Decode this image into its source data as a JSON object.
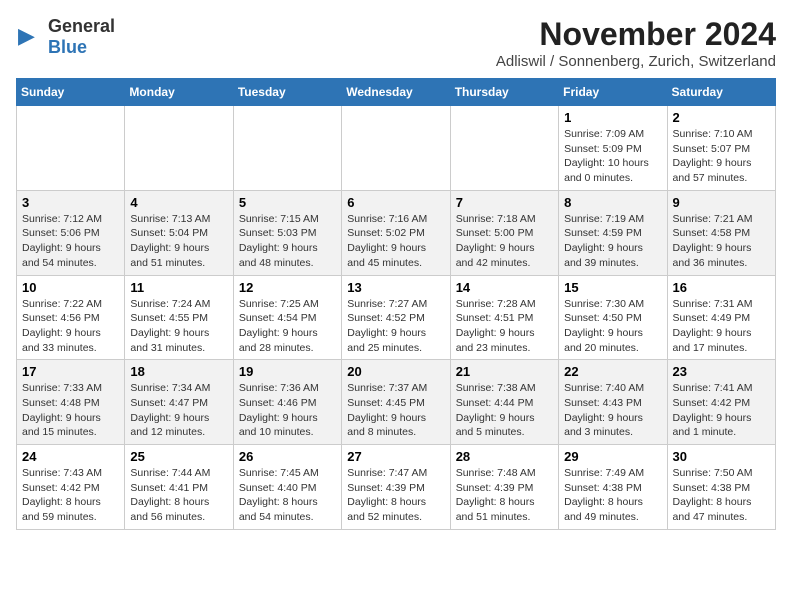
{
  "logo": {
    "text_general": "General",
    "text_blue": "Blue"
  },
  "title": "November 2024",
  "subtitle": "Adliswil / Sonnenberg, Zurich, Switzerland",
  "weekdays": [
    "Sunday",
    "Monday",
    "Tuesday",
    "Wednesday",
    "Thursday",
    "Friday",
    "Saturday"
  ],
  "weeks": [
    [
      {
        "day": "",
        "info": ""
      },
      {
        "day": "",
        "info": ""
      },
      {
        "day": "",
        "info": ""
      },
      {
        "day": "",
        "info": ""
      },
      {
        "day": "",
        "info": ""
      },
      {
        "day": "1",
        "info": "Sunrise: 7:09 AM\nSunset: 5:09 PM\nDaylight: 10 hours and 0 minutes."
      },
      {
        "day": "2",
        "info": "Sunrise: 7:10 AM\nSunset: 5:07 PM\nDaylight: 9 hours and 57 minutes."
      }
    ],
    [
      {
        "day": "3",
        "info": "Sunrise: 7:12 AM\nSunset: 5:06 PM\nDaylight: 9 hours and 54 minutes."
      },
      {
        "day": "4",
        "info": "Sunrise: 7:13 AM\nSunset: 5:04 PM\nDaylight: 9 hours and 51 minutes."
      },
      {
        "day": "5",
        "info": "Sunrise: 7:15 AM\nSunset: 5:03 PM\nDaylight: 9 hours and 48 minutes."
      },
      {
        "day": "6",
        "info": "Sunrise: 7:16 AM\nSunset: 5:02 PM\nDaylight: 9 hours and 45 minutes."
      },
      {
        "day": "7",
        "info": "Sunrise: 7:18 AM\nSunset: 5:00 PM\nDaylight: 9 hours and 42 minutes."
      },
      {
        "day": "8",
        "info": "Sunrise: 7:19 AM\nSunset: 4:59 PM\nDaylight: 9 hours and 39 minutes."
      },
      {
        "day": "9",
        "info": "Sunrise: 7:21 AM\nSunset: 4:58 PM\nDaylight: 9 hours and 36 minutes."
      }
    ],
    [
      {
        "day": "10",
        "info": "Sunrise: 7:22 AM\nSunset: 4:56 PM\nDaylight: 9 hours and 33 minutes."
      },
      {
        "day": "11",
        "info": "Sunrise: 7:24 AM\nSunset: 4:55 PM\nDaylight: 9 hours and 31 minutes."
      },
      {
        "day": "12",
        "info": "Sunrise: 7:25 AM\nSunset: 4:54 PM\nDaylight: 9 hours and 28 minutes."
      },
      {
        "day": "13",
        "info": "Sunrise: 7:27 AM\nSunset: 4:52 PM\nDaylight: 9 hours and 25 minutes."
      },
      {
        "day": "14",
        "info": "Sunrise: 7:28 AM\nSunset: 4:51 PM\nDaylight: 9 hours and 23 minutes."
      },
      {
        "day": "15",
        "info": "Sunrise: 7:30 AM\nSunset: 4:50 PM\nDaylight: 9 hours and 20 minutes."
      },
      {
        "day": "16",
        "info": "Sunrise: 7:31 AM\nSunset: 4:49 PM\nDaylight: 9 hours and 17 minutes."
      }
    ],
    [
      {
        "day": "17",
        "info": "Sunrise: 7:33 AM\nSunset: 4:48 PM\nDaylight: 9 hours and 15 minutes."
      },
      {
        "day": "18",
        "info": "Sunrise: 7:34 AM\nSunset: 4:47 PM\nDaylight: 9 hours and 12 minutes."
      },
      {
        "day": "19",
        "info": "Sunrise: 7:36 AM\nSunset: 4:46 PM\nDaylight: 9 hours and 10 minutes."
      },
      {
        "day": "20",
        "info": "Sunrise: 7:37 AM\nSunset: 4:45 PM\nDaylight: 9 hours and 8 minutes."
      },
      {
        "day": "21",
        "info": "Sunrise: 7:38 AM\nSunset: 4:44 PM\nDaylight: 9 hours and 5 minutes."
      },
      {
        "day": "22",
        "info": "Sunrise: 7:40 AM\nSunset: 4:43 PM\nDaylight: 9 hours and 3 minutes."
      },
      {
        "day": "23",
        "info": "Sunrise: 7:41 AM\nSunset: 4:42 PM\nDaylight: 9 hours and 1 minute."
      }
    ],
    [
      {
        "day": "24",
        "info": "Sunrise: 7:43 AM\nSunset: 4:42 PM\nDaylight: 8 hours and 59 minutes."
      },
      {
        "day": "25",
        "info": "Sunrise: 7:44 AM\nSunset: 4:41 PM\nDaylight: 8 hours and 56 minutes."
      },
      {
        "day": "26",
        "info": "Sunrise: 7:45 AM\nSunset: 4:40 PM\nDaylight: 8 hours and 54 minutes."
      },
      {
        "day": "27",
        "info": "Sunrise: 7:47 AM\nSunset: 4:39 PM\nDaylight: 8 hours and 52 minutes."
      },
      {
        "day": "28",
        "info": "Sunrise: 7:48 AM\nSunset: 4:39 PM\nDaylight: 8 hours and 51 minutes."
      },
      {
        "day": "29",
        "info": "Sunrise: 7:49 AM\nSunset: 4:38 PM\nDaylight: 8 hours and 49 minutes."
      },
      {
        "day": "30",
        "info": "Sunrise: 7:50 AM\nSunset: 4:38 PM\nDaylight: 8 hours and 47 minutes."
      }
    ]
  ]
}
